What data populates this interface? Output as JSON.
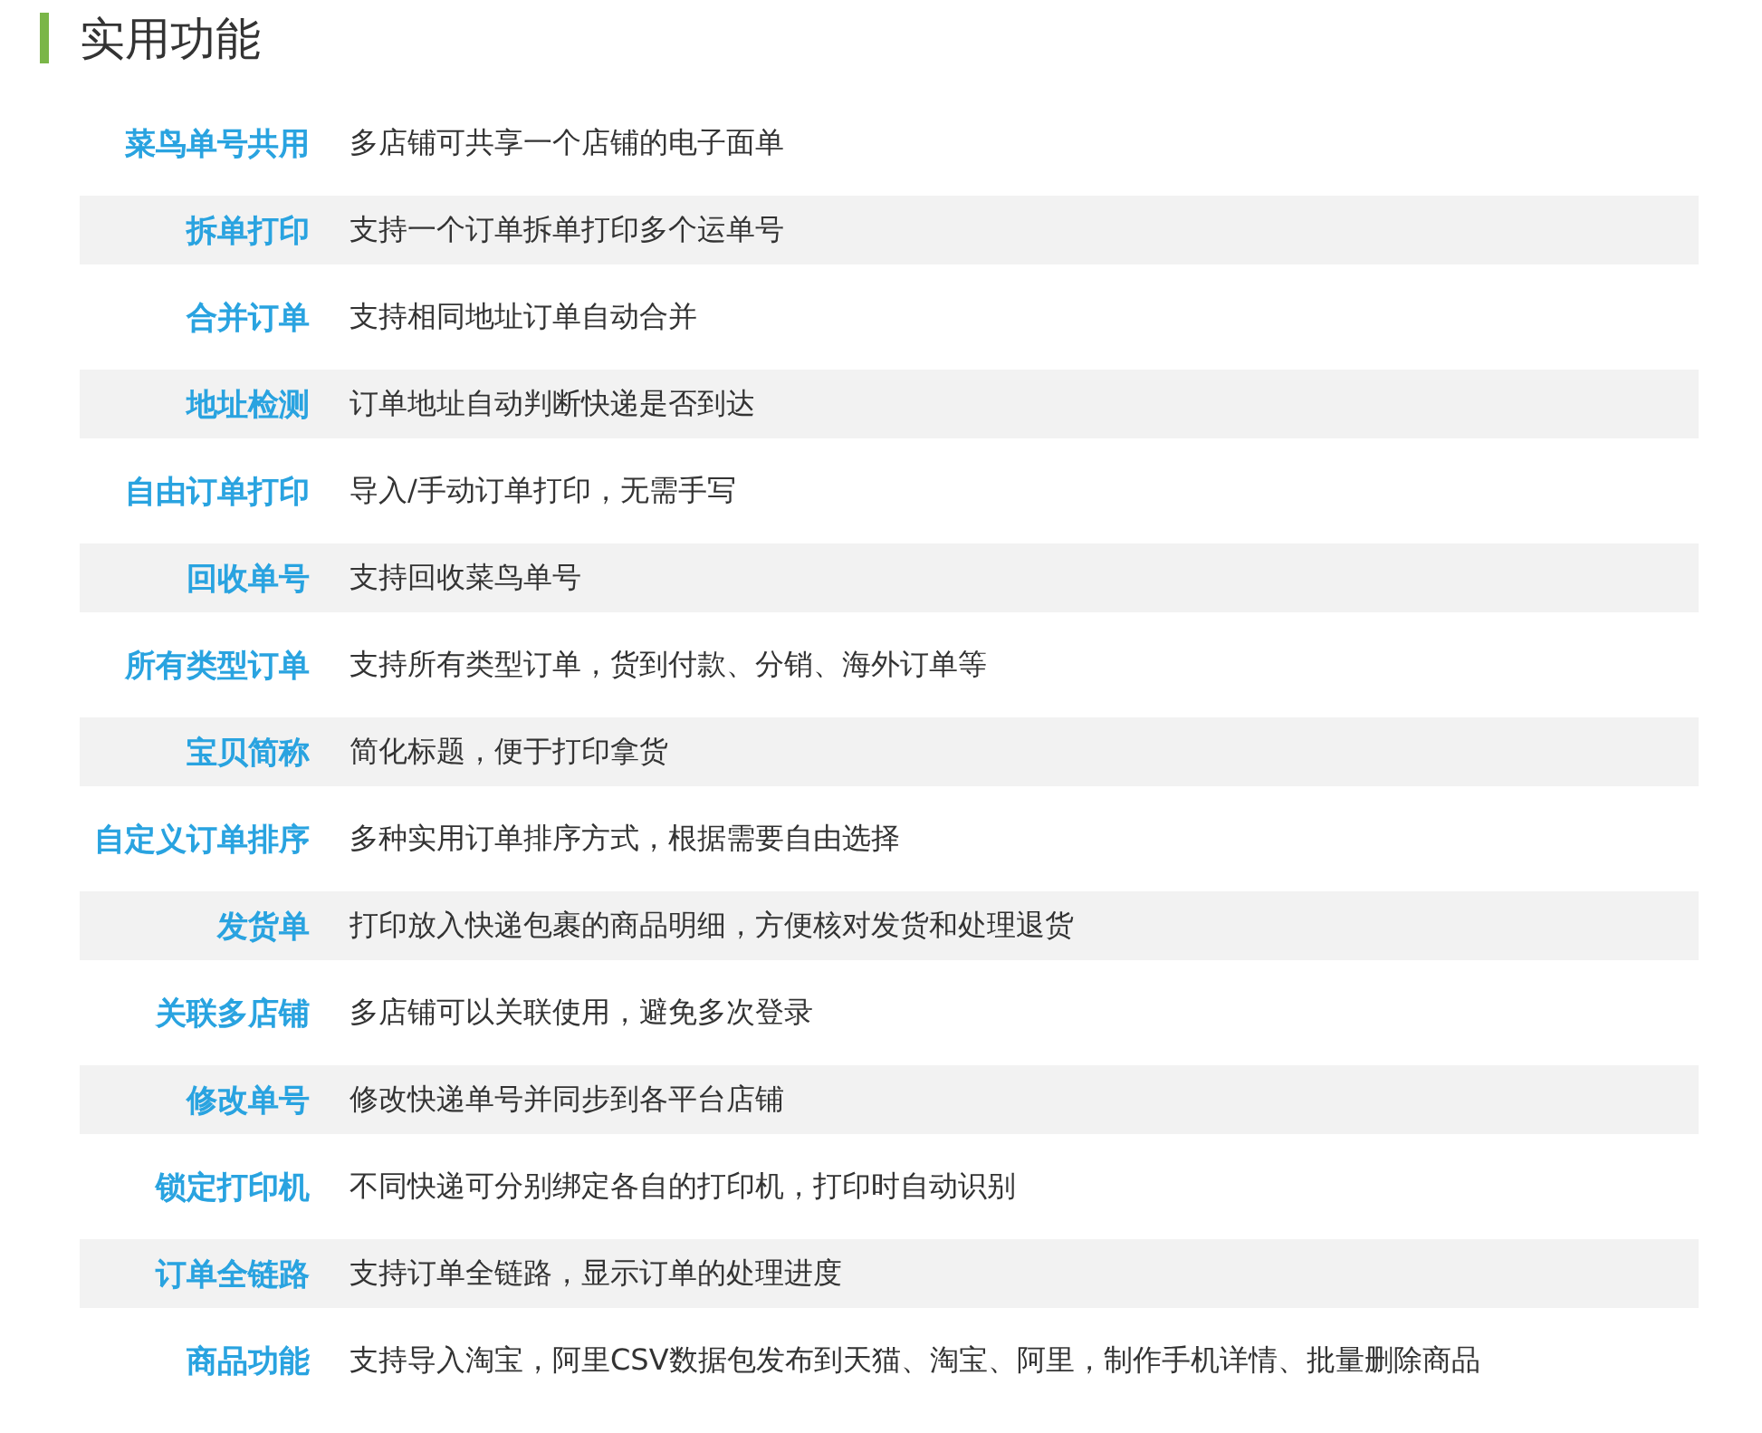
{
  "section": {
    "title": "实用功能"
  },
  "features": [
    {
      "name": "菜鸟单号共用",
      "description": "多店铺可共享一个店铺的电子面单"
    },
    {
      "name": "拆单打印",
      "description": "支持一个订单拆单打印多个运单号"
    },
    {
      "name": "合并订单",
      "description": "支持相同地址订单自动合并"
    },
    {
      "name": "地址检测",
      "description": "订单地址自动判断快递是否到达"
    },
    {
      "name": "自由订单打印",
      "description": "导入/手动订单打印，无需手写"
    },
    {
      "name": "回收单号",
      "description": "支持回收菜鸟单号"
    },
    {
      "name": "所有类型订单",
      "description": "支持所有类型订单，货到付款、分销、海外订单等"
    },
    {
      "name": "宝贝简称",
      "description": "简化标题，便于打印拿货"
    },
    {
      "name": "自定义订单排序",
      "description": "多种实用订单排序方式，根据需要自由选择"
    },
    {
      "name": "发货单",
      "description": "打印放入快递包裹的商品明细，方便核对发货和处理退货"
    },
    {
      "name": "关联多店铺",
      "description": "多店铺可以关联使用，避免多次登录"
    },
    {
      "name": "修改单号",
      "description": "修改快递单号并同步到各平台店铺"
    },
    {
      "name": "锁定打印机",
      "description": "不同快递可分别绑定各自的打印机，打印时自动识别"
    },
    {
      "name": "订单全链路",
      "description": "支持订单全链路，显示订单的处理进度"
    },
    {
      "name": "商品功能",
      "description": "支持导入淘宝，阿里CSV数据包发布到天猫、淘宝、阿里，制作手机详情、批量删除商品"
    }
  ]
}
